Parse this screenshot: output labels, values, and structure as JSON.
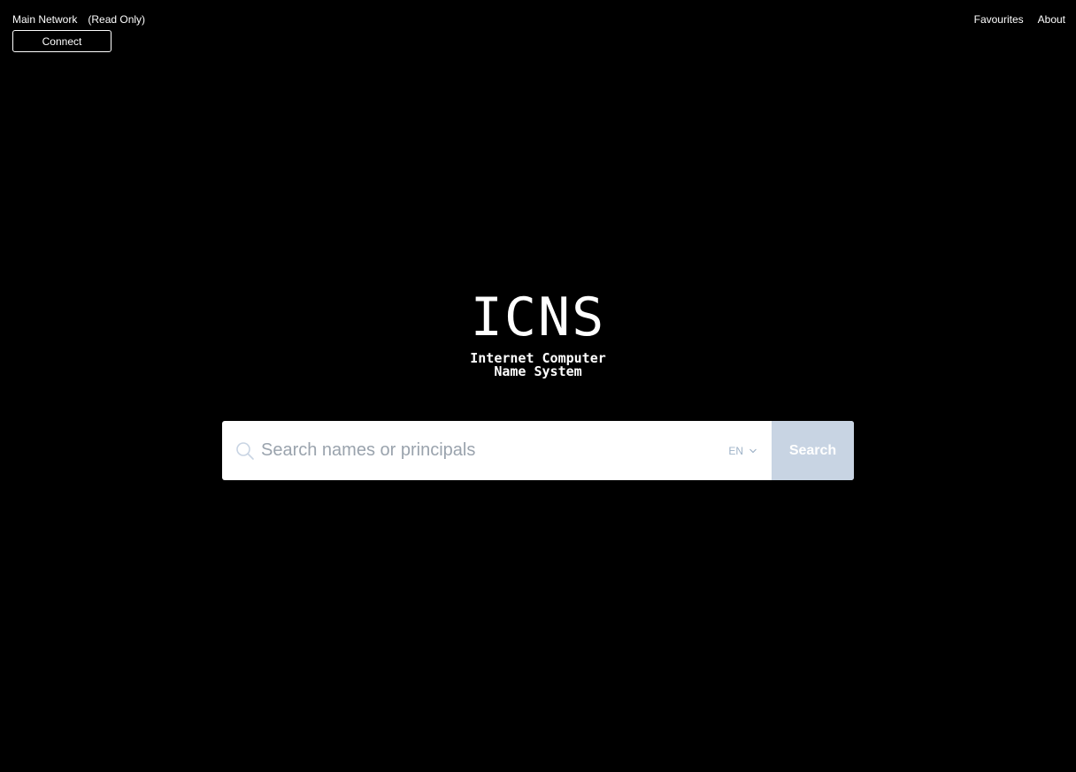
{
  "header": {
    "network": "Main Network",
    "mode": "(Read Only)",
    "connect_label": "Connect",
    "nav": {
      "favourites": "Favourites",
      "about": "About"
    }
  },
  "brand": {
    "logo": "ICNS",
    "tagline_line1": "Internet Computer",
    "tagline_line2": "Name System"
  },
  "search": {
    "placeholder": "Search names or principals",
    "value": "",
    "language": "EN",
    "button_label": "Search",
    "icon": "search-icon"
  },
  "colors": {
    "background": "#000000",
    "search_button": "#c8d4e3",
    "language_text": "#9fb3c8"
  }
}
